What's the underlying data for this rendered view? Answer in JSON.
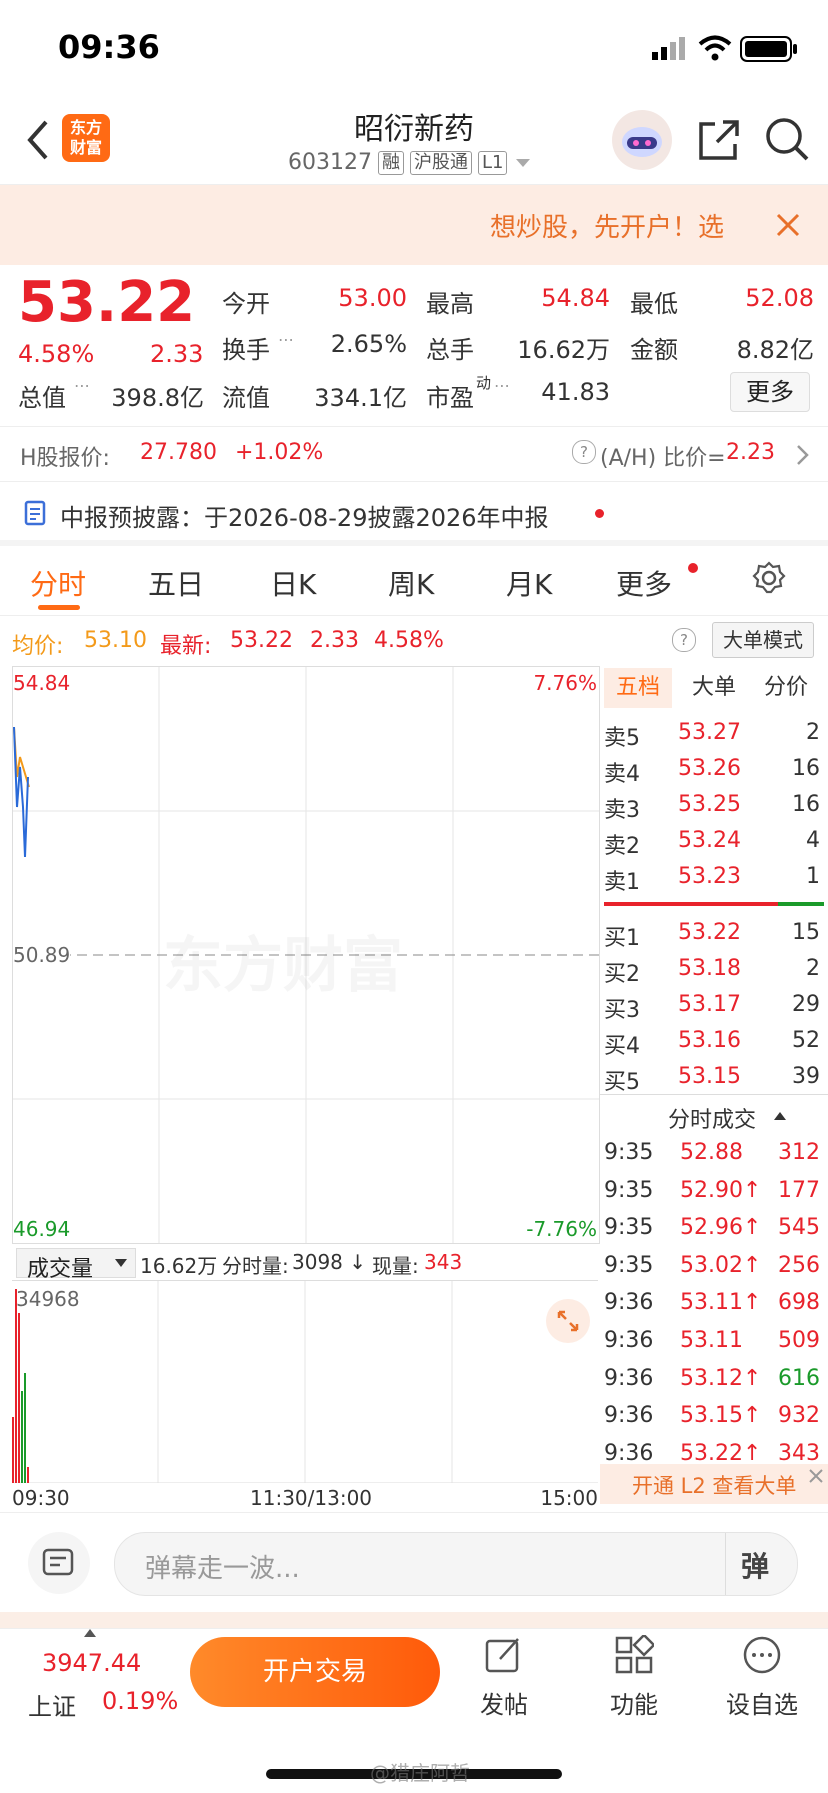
{
  "status_bar": {
    "time": "09:36"
  },
  "header": {
    "logo_text": "东方\n财富",
    "stock_name": "昭衍新药",
    "stock_code": "603127",
    "tags": [
      "融",
      "沪股通",
      "L1"
    ]
  },
  "banner": {
    "text": "想炒股，先开户！选"
  },
  "quote": {
    "price": "53.22",
    "change_pct": "4.58%",
    "change": "2.33",
    "open_label": "今开",
    "open": "53.00",
    "high_label": "最高",
    "high": "54.84",
    "low_label": "最低",
    "low": "52.08",
    "turnover_label": "换手",
    "turnover": "2.65%",
    "volume_label": "总手",
    "volume": "16.62万",
    "amount_label": "金额",
    "amount": "8.82亿",
    "mktcap_label": "总值",
    "mktcap": "398.8亿",
    "float_label": "流值",
    "float": "334.1亿",
    "pe_label": "市盈",
    "pe_sup": "动",
    "pe": "41.83",
    "more_label": "更多"
  },
  "hshare": {
    "label": "H股报价:",
    "price": "27.780",
    "change": "+1.02%",
    "ah_label": "(A/H) 比价=",
    "ah_value": "2.23"
  },
  "notice": {
    "text": "中报预披露：于2026-08-29披露2026年中报"
  },
  "tabs": [
    "分时",
    "五日",
    "日K",
    "周K",
    "月K",
    "更多"
  ],
  "info_line": {
    "avg_label": "均价:",
    "avg": "53.10",
    "latest_label": "最新:",
    "latest": "53.22",
    "chg": "2.33",
    "pct": "4.58%",
    "mode_button": "大单模式"
  },
  "chart": {
    "top_price": "54.84",
    "mid_price": "50.89",
    "bottom_price": "46.94",
    "top_pct": "7.76%",
    "bottom_pct": "-7.76%",
    "watermark": "东方财富",
    "time_start": "09:30",
    "time_mid": "11:30/13:00",
    "time_end": "15:00"
  },
  "volume": {
    "selector": "成交量",
    "total": "16.62万",
    "period_label": "分时量:",
    "period_value": "3098 ↓",
    "current_label": "现量:",
    "current_value": "343",
    "max_label": "34968"
  },
  "book_tabs": [
    "五档",
    "大单",
    "分价"
  ],
  "asks": [
    {
      "label": "卖5",
      "price": "53.27",
      "qty": "2"
    },
    {
      "label": "卖4",
      "price": "53.26",
      "qty": "16"
    },
    {
      "label": "卖3",
      "price": "53.25",
      "qty": "16"
    },
    {
      "label": "卖2",
      "price": "53.24",
      "qty": "4"
    },
    {
      "label": "卖1",
      "price": "53.23",
      "qty": "1"
    }
  ],
  "bids": [
    {
      "label": "买1",
      "price": "53.22",
      "qty": "15"
    },
    {
      "label": "买2",
      "price": "53.18",
      "qty": "2"
    },
    {
      "label": "买3",
      "price": "53.17",
      "qty": "29"
    },
    {
      "label": "买4",
      "price": "53.16",
      "qty": "52"
    },
    {
      "label": "买5",
      "price": "53.15",
      "qty": "39"
    }
  ],
  "trades_title": "分时成交",
  "trades": [
    {
      "time": "9:35",
      "price": "52.88",
      "qty": "312",
      "color": "#e8222b"
    },
    {
      "time": "9:35",
      "price": "52.90↑",
      "qty": "177",
      "color": "#e8222b"
    },
    {
      "time": "9:35",
      "price": "52.96↑",
      "qty": "545",
      "color": "#e8222b"
    },
    {
      "time": "9:35",
      "price": "53.02↑",
      "qty": "256",
      "color": "#e8222b"
    },
    {
      "time": "9:36",
      "price": "53.11↑",
      "qty": "698",
      "color": "#e8222b"
    },
    {
      "time": "9:36",
      "price": "53.11",
      "qty": "509",
      "color": "#e8222b"
    },
    {
      "time": "9:36",
      "price": "53.12↑",
      "qty": "616",
      "color": "#1a9a2a"
    },
    {
      "time": "9:36",
      "price": "53.15↑",
      "qty": "932",
      "color": "#e8222b"
    },
    {
      "time": "9:36",
      "price": "53.22↑",
      "qty": "343",
      "color": "#e8222b"
    }
  ],
  "l2_promo": "开通 L2 查看大单",
  "comment": {
    "placeholder": "弹幕走一波...",
    "danmaku_label": "弹"
  },
  "tabbar": {
    "index_value": "3947.44",
    "index_name": "上证",
    "index_pct": "0.19%",
    "trade_button": "开户交易",
    "post_label": "发帖",
    "func_label": "功能",
    "watch_label": "设自选"
  },
  "watermark_footer": "@猎庄阿哲",
  "colors": {
    "up": "#e8222b",
    "down": "#1a9a2a",
    "accent": "#ff6a14",
    "avg_line": "#f39a1a"
  }
}
